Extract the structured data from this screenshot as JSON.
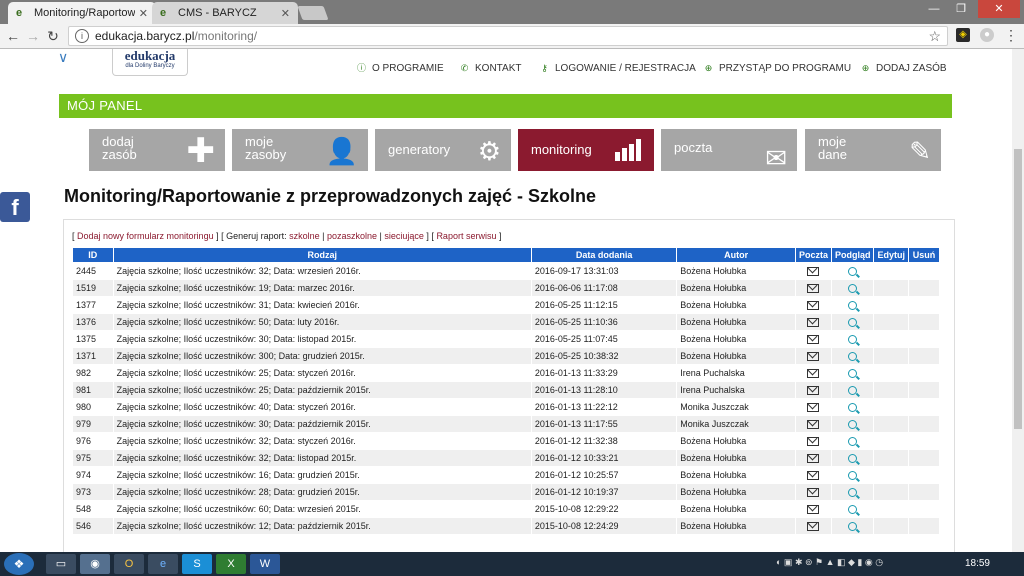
{
  "browser": {
    "tabs": [
      {
        "label": "Monitoring/Raportowan",
        "active": true
      },
      {
        "label": "CMS - BARYCZ",
        "active": false
      }
    ],
    "url_host": "edukacja.barycz.pl",
    "url_path": "/monitoring/"
  },
  "site": {
    "logo_title": "edukacja",
    "logo_subtitle": "dla Doliny Baryczy",
    "nav": [
      {
        "label": "O PROGRAMIE",
        "icon": "info-icon"
      },
      {
        "label": "KONTAKT",
        "icon": "phone-icon"
      },
      {
        "label": "LOGOWANIE / REJESTRACJA",
        "icon": "key-icon"
      },
      {
        "label": "PRZYSTĄP DO PROGRAMU",
        "icon": "plus-circle-icon"
      },
      {
        "label": "DODAJ ZASÓB",
        "icon": "plus-circle-outline-icon"
      }
    ],
    "panel_title": "MÓJ PANEL",
    "tiles": [
      {
        "line1": "dodaj",
        "line2": "zasób",
        "icon": "plus-icon",
        "active": false
      },
      {
        "line1": "moje",
        "line2": "zasoby",
        "icon": "user-icon",
        "active": false
      },
      {
        "line1": "generatory",
        "line2": "",
        "icon": "gear-icon",
        "active": false
      },
      {
        "line1": "monitoring",
        "line2": "",
        "icon": "bar-chart-icon",
        "active": true
      },
      {
        "line1": "poczta",
        "line2": "",
        "icon": "envelope-icon",
        "active": false
      },
      {
        "line1": "moje",
        "line2": "dane",
        "icon": "edit-icon",
        "active": false
      }
    ],
    "heading": "Monitoring/Raportowanie z przeprowadzonych zajęć - Szkolne",
    "links": {
      "add_form": "Dodaj nowy formularz monitoringu",
      "generate_prefix": "Generuj raport:",
      "szkolne": "szkolne",
      "pozaszkolne": "pozaszkolne",
      "sieciujace": "sieciujące",
      "service_report": "Raport serwisu"
    }
  },
  "table": {
    "headers": [
      "ID",
      "Rodzaj",
      "Data dodania",
      "Autor",
      "Poczta",
      "Podgląd",
      "Edytuj",
      "Usuń"
    ],
    "rows": [
      {
        "id": "2445",
        "rodzaj": "Zajęcia szkolne; Ilość uczestników: 32; Data: wrzesień 2016r.",
        "data": "2016-09-17 13:31:03",
        "autor": "Bożena Hołubka"
      },
      {
        "id": "1519",
        "rodzaj": "Zajęcia szkolne; Ilość uczestników: 19; Data: marzec 2016r.",
        "data": "2016-06-06 11:17:08",
        "autor": "Bożena Hołubka"
      },
      {
        "id": "1377",
        "rodzaj": "Zajęcia szkolne; Ilość uczestników: 31; Data: kwiecień 2016r.",
        "data": "2016-05-25 11:12:15",
        "autor": "Bożena Hołubka"
      },
      {
        "id": "1376",
        "rodzaj": "Zajęcia szkolne; Ilość uczestników: 50; Data: luty 2016r.",
        "data": "2016-05-25 11:10:36",
        "autor": "Bożena Hołubka"
      },
      {
        "id": "1375",
        "rodzaj": "Zajęcia szkolne; Ilość uczestników: 30; Data: listopad 2015r.",
        "data": "2016-05-25 11:07:45",
        "autor": "Bożena Hołubka"
      },
      {
        "id": "1371",
        "rodzaj": "Zajęcia szkolne; Ilość uczestników: 300; Data: grudzień 2015r.",
        "data": "2016-05-25 10:38:32",
        "autor": "Bożena Hołubka"
      },
      {
        "id": "982",
        "rodzaj": "Zajęcia szkolne; Ilość uczestników: 25; Data: styczeń 2016r.",
        "data": "2016-01-13 11:33:29",
        "autor": "Irena Puchalska"
      },
      {
        "id": "981",
        "rodzaj": "Zajęcia szkolne; Ilość uczestników: 25; Data: październik 2015r.",
        "data": "2016-01-13 11:28:10",
        "autor": "Irena Puchalska"
      },
      {
        "id": "980",
        "rodzaj": "Zajęcia szkolne; Ilość uczestników: 40; Data: styczeń 2016r.",
        "data": "2016-01-13 11:22:12",
        "autor": "Monika Juszczak"
      },
      {
        "id": "979",
        "rodzaj": "Zajęcia szkolne; Ilość uczestników: 30; Data: październik 2015r.",
        "data": "2016-01-13 11:17:55",
        "autor": "Monika Juszczak"
      },
      {
        "id": "976",
        "rodzaj": "Zajęcia szkolne; Ilość uczestników: 32; Data: styczeń 2016r.",
        "data": "2016-01-12 11:32:38",
        "autor": "Bożena Hołubka"
      },
      {
        "id": "975",
        "rodzaj": "Zajęcia szkolne; Ilość uczestników: 32; Data: listopad 2015r.",
        "data": "2016-01-12 10:33:21",
        "autor": "Bożena Hołubka"
      },
      {
        "id": "974",
        "rodzaj": "Zajęcia szkolne; Ilość uczestników: 16; Data: grudzień 2015r.",
        "data": "2016-01-12 10:25:57",
        "autor": "Bożena Hołubka"
      },
      {
        "id": "973",
        "rodzaj": "Zajęcia szkolne; Ilość uczestników: 28; Data: grudzień 2015r.",
        "data": "2016-01-12 10:19:37",
        "autor": "Bożena Hołubka"
      },
      {
        "id": "548",
        "rodzaj": "Zajęcia szkolne; Ilość uczestników: 60; Data: wrzesień 2015r.",
        "data": "2015-10-08 12:29:22",
        "autor": "Bożena Hołubka"
      },
      {
        "id": "546",
        "rodzaj": "Zajęcia szkolne; Ilość uczestników: 12; Data: październik 2015r.",
        "data": "2015-10-08 12:24:29",
        "autor": "Bożena Hołubka"
      }
    ]
  },
  "taskbar": {
    "clock": "18:59"
  },
  "colors": {
    "green": "#77c21e",
    "maroon": "#8b1a2f",
    "table_header": "#1e63c6",
    "tile_grey": "#a6a6a6"
  }
}
